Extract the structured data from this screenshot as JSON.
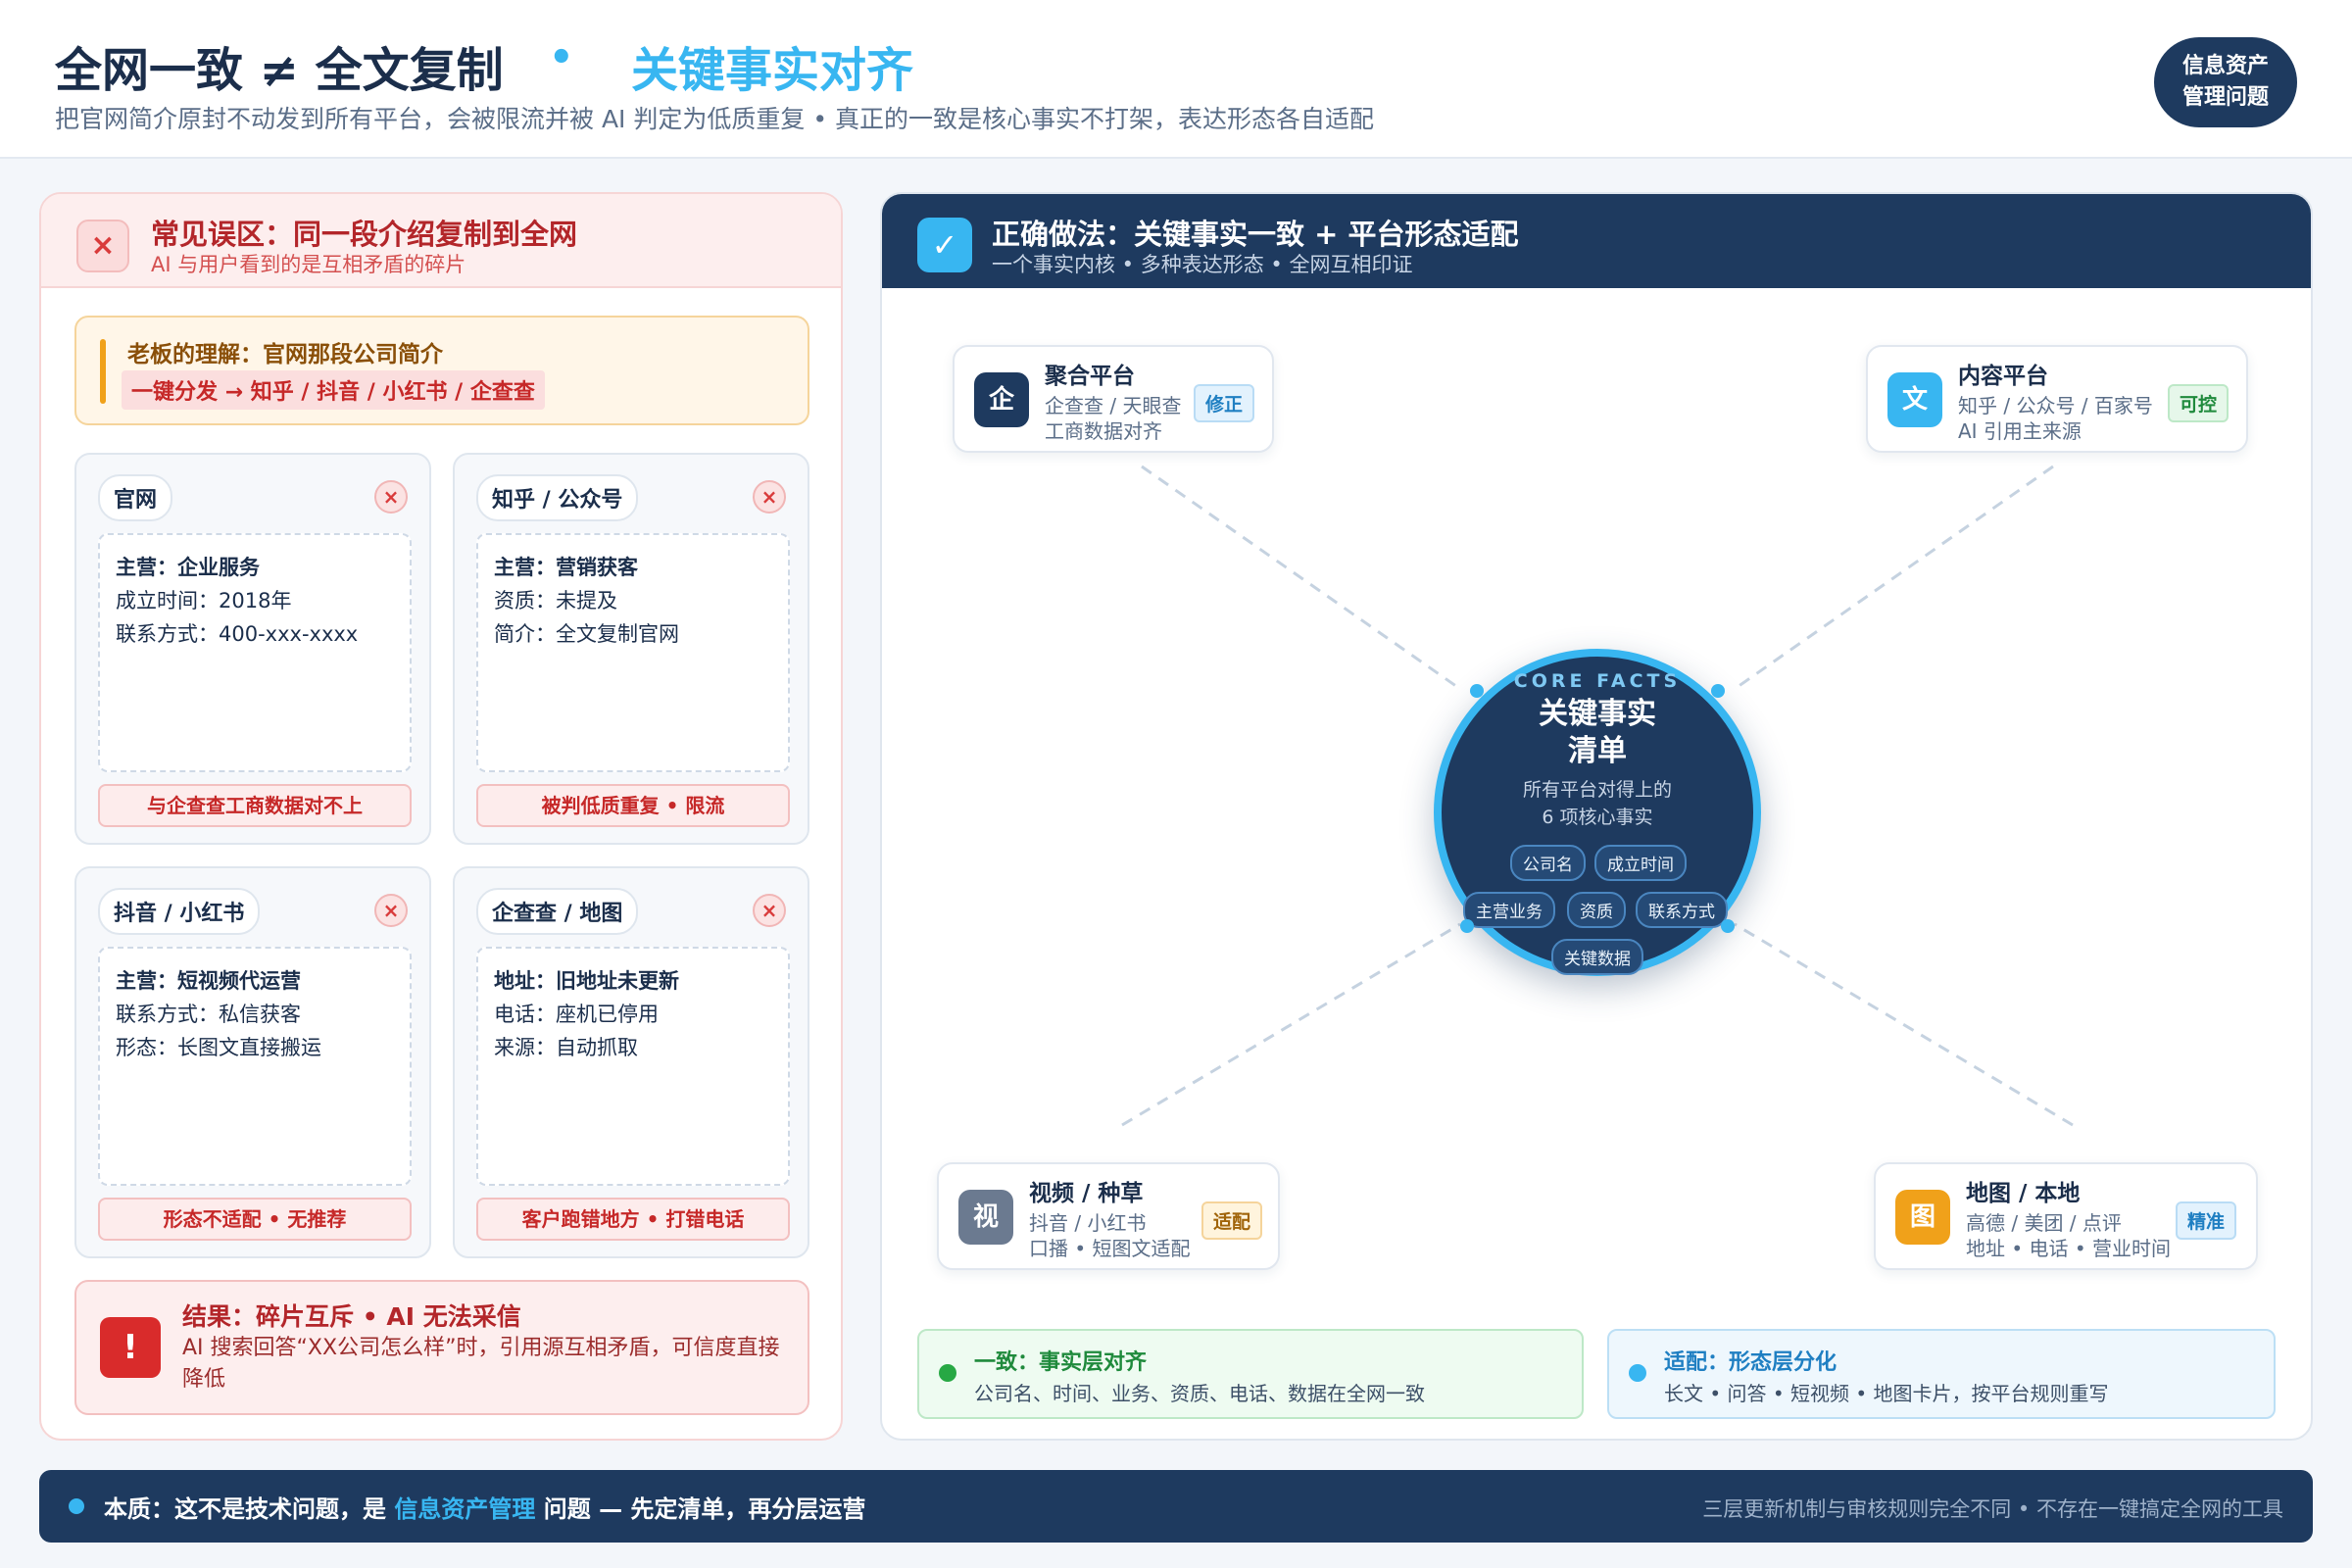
{
  "header": {
    "title_main": "全网一致 ≠ 全文复制",
    "title_sep": "•",
    "title_accent": "关键事实对齐",
    "subtitle": "把官网简介原封不动发到所有平台，会被限流并被 AI 判定为低质重复 • 真正的一致是核心事实不打架，表达形态各自适配",
    "badge_line1": "信息资产",
    "badge_line2": "管理问题"
  },
  "left": {
    "icon": "×",
    "title": "常见误区：同一段介绍复制到全网",
    "subtitle": "AI 与用户看到的是互相矛盾的碎片",
    "boss_title": "老板的理解：官网那段公司简介",
    "boss_tag": "一键分发 → 知乎 / 抖音 / 小红书 / 企查查",
    "cards": [
      {
        "name": "官网",
        "l1": "主营：企业服务",
        "l2": "成立时间：2018年",
        "l3": "联系方式：400-xxx-xxxx",
        "foot": "与企查查工商数据对不上"
      },
      {
        "name": "知乎 / 公众号",
        "l1": "主营：营销获客",
        "l2": "资质：未提及",
        "l3": "简介：全文复制官网",
        "foot": "被判低质重复 • 限流"
      },
      {
        "name": "抖音 / 小红书",
        "l1": "主营：短视频代运营",
        "l2": "联系方式：私信获客",
        "l3": "形态：长图文直接搬运",
        "foot": "形态不适配 • 无推荐"
      },
      {
        "name": "企查查 / 地图",
        "l1": "地址：旧地址未更新",
        "l2": "电话：座机已停用",
        "l3": "来源：自动抓取",
        "foot": "客户跑错地方 • 打错电话"
      }
    ],
    "card_close": "×",
    "result_icon": "!",
    "result_title": "结果：碎片互斥 • AI 无法采信",
    "result_text": "AI 搜索回答“XX公司怎么样”时，引用源互相矛盾，可信度直接降低"
  },
  "right": {
    "icon": "✓",
    "title": "正确做法：关键事实一致 + 平台形态适配",
    "subtitle": "一个事实内核 • 多种表达形态 • 全网互相印证",
    "core": {
      "en": "CORE FACTS",
      "title_l1": "关键事实",
      "title_l2": "清单",
      "desc_l1": "所有平台对得上的",
      "desc_l2": "6 项核心事实",
      "chips": [
        "公司名",
        "成立时间",
        "主营业务",
        "资质",
        "联系方式",
        "关键数据"
      ]
    },
    "nodes": [
      {
        "icon": "企",
        "title": "聚合平台",
        "l2": "企查查 / 天眼查",
        "l3": "工商数据对齐",
        "tag": "修正"
      },
      {
        "icon": "文",
        "title": "内容平台",
        "l2": "知乎 / 公众号 / 百家号",
        "l3": "AI 引用主来源",
        "tag": "可控"
      },
      {
        "icon": "视",
        "title": "视频 / 种草",
        "l2": "抖音 / 小红书",
        "l3": "口播 • 短图文适配",
        "tag": "适配"
      },
      {
        "icon": "图",
        "title": "地图 / 本地",
        "l2": "高德 / 美团 / 点评",
        "l3": "地址 • 电话 • 营业时间",
        "tag": "精准"
      }
    ],
    "align_title": "一致：事实层对齐",
    "align_text": "公司名、时间、业务、资质、电话、数据在全网一致",
    "adapt_title": "适配：形态层分化",
    "adapt_text": "长文 • 问答 • 短视频 • 地图卡片，按平台规则重写"
  },
  "footer": {
    "left_pre": "本质：这不是技术问题，是 ",
    "left_hl": "信息资产管理",
    "left_post": " 问题 — 先定清单，再分层运营",
    "right": "三层更新机制与审核规则完全不同 • 不存在一键搞定全网的工具"
  },
  "colors": {
    "navy": "#1e3a5f",
    "accent": "#38b6f1",
    "error": "#d93b3b",
    "warning": "#f0a11a",
    "success": "#27a844"
  }
}
